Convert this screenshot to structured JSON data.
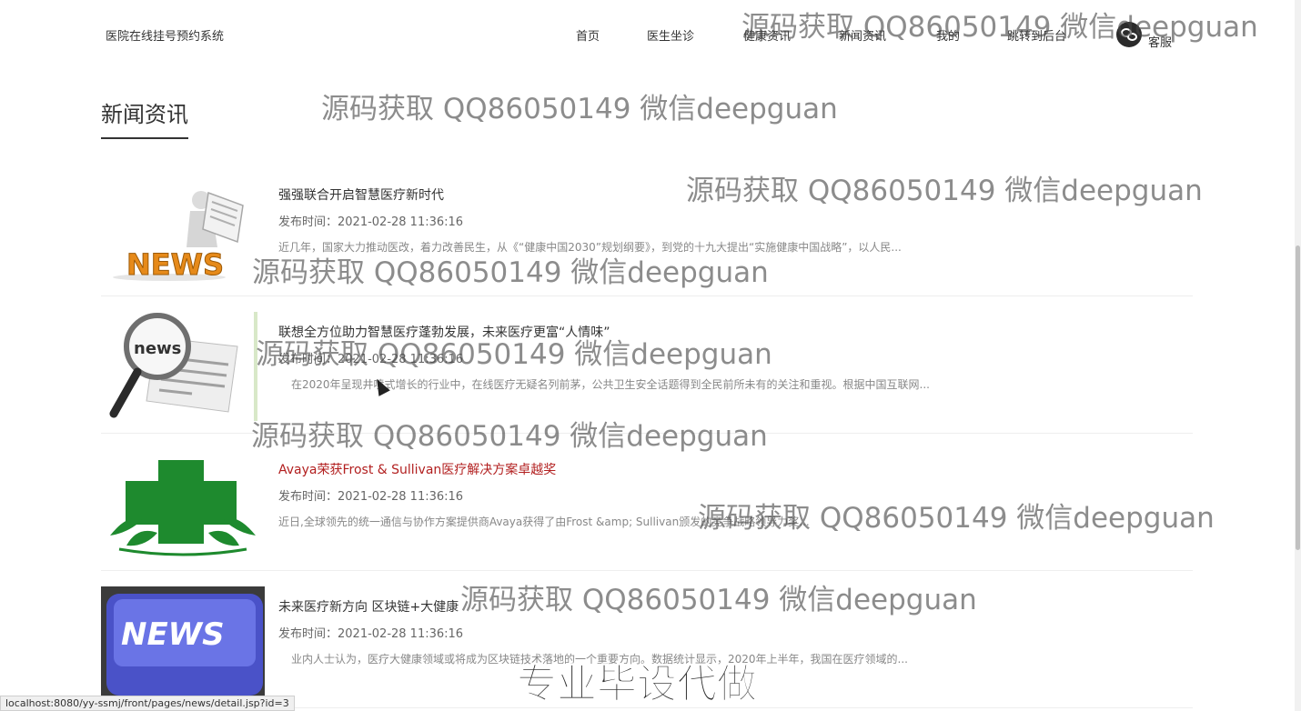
{
  "header": {
    "brand": "医院在线挂号预约系统",
    "nav": [
      {
        "label": "首页"
      },
      {
        "label": "医生坐诊"
      },
      {
        "label": "健康资讯"
      },
      {
        "label": "新闻资讯"
      },
      {
        "label": "我的"
      },
      {
        "label": "跳转到后台"
      }
    ],
    "customer_service": "客服"
  },
  "section_title": "新闻资讯",
  "news": [
    {
      "title": "强强联合开启智慧医疗新时代",
      "time": "发布时间：2021-02-28 11:36:16",
      "summary": "近几年，国家大力推动医改，着力改善民生，从《“健康中国2030”规划纲要》，到党的十九大提出“实施健康中国战略”，以人民...",
      "thumb": "news-reader-figure"
    },
    {
      "title": "联想全方位助力智慧医疗蓬勃发展，未来医疗更富“人情味”",
      "time": "发布时间：2021-02-28 11:36:16",
      "summary": "在2020年呈现井喷式增长的行业中，在线医疗无疑名列前茅，公共卫生安全话题得到全民前所未有的关注和重视。根据中国互联网...",
      "thumb": "newspaper-magnifier"
    },
    {
      "title": "Avaya荣获Frost & Sullivan医疗解决方案卓越奖",
      "time": "发布时间：2021-02-28 11:36:16",
      "summary": "近日,全球领先的统一通信与协作方案提供商Avaya获得了由Frost &amp; Sullivan颁发的竞争战略领导力奖...",
      "thumb": "green-cross-logo"
    },
    {
      "title": "未来医疗新方向 区块链+大健康",
      "time": "发布时间：2021-02-28 11:36:16",
      "summary": "业内人士认为，医疗大健康领域或将成为区块链技术落地的一个重要方向。数据统计显示，2020年上半年，我国在医疗领域的...",
      "thumb": "news-keyboard-key"
    }
  ],
  "watermark_text": "源码获取 QQ86050149 微信deepguan",
  "stamp_text": "专业毕设代做",
  "status_url": "localhost:8080/yy-ssmj/front/pages/news/detail.jsp?id=3",
  "colors": {
    "active_title": "#b21f1f",
    "cross_green": "#1e8a2e",
    "key_blue": "#5560d8"
  }
}
